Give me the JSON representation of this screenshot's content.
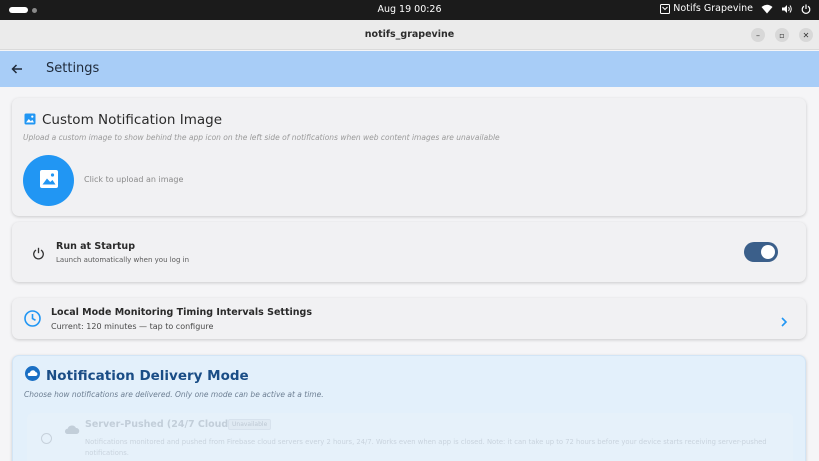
{
  "system_bar": {
    "datetime": "Aug 19  00:26",
    "tray_app": "Notifs Grapevine"
  },
  "window": {
    "title": "notifs_grapevine",
    "minimize": "–",
    "maximize": "▫",
    "close": "✕"
  },
  "appbar": {
    "title": "Settings"
  },
  "custom_image": {
    "title": "Custom Notification Image",
    "description": "Upload a custom image to show behind the app icon on the left side of notifications when web content images are unavailable",
    "upload_label": "Click to upload an image"
  },
  "startup": {
    "title": "Run at Startup",
    "subtitle": "Launch automatically when you log in",
    "enabled": true
  },
  "timing": {
    "title": "Local Mode Monitoring Timing Intervals Settings",
    "subtitle": "Current: 120 minutes — tap to configure"
  },
  "delivery": {
    "title": "Notification Delivery Mode",
    "description": "Choose how notifications are delivered. Only one mode can be active at a time.",
    "options": [
      {
        "title": "Server-Pushed (24/7 Cloud)",
        "badge": "Unavailable",
        "description": "Notifications monitored and pushed from Firebase cloud servers every 2 hours, 24/7. Works even when app is closed. Note: it can take up to 72 hours before your device starts receiving server-pushed notifications."
      }
    ]
  },
  "colors": {
    "appbar": "#a8cdf7",
    "accent": "#2196f3",
    "toggle_on": "#3b5f8a",
    "delivery_title": "#1a4d86"
  }
}
